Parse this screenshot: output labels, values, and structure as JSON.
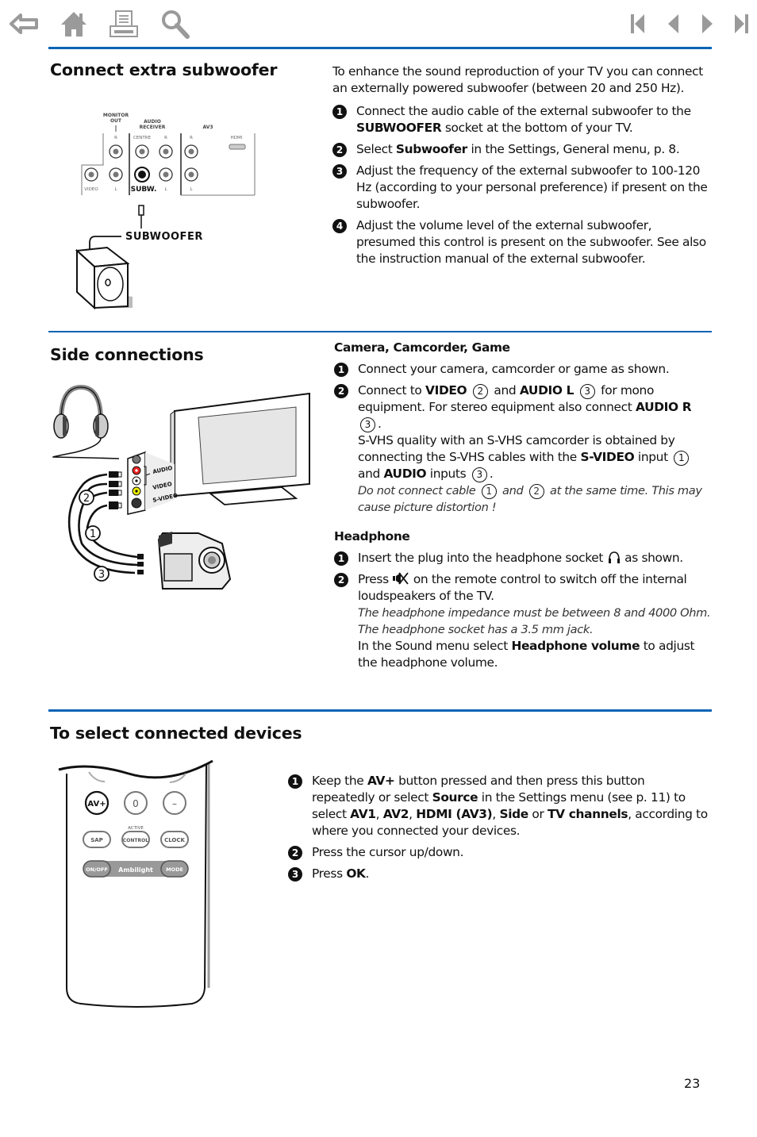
{
  "nav": {
    "left": [
      {
        "name": "back-icon"
      },
      {
        "name": "home-icon"
      },
      {
        "name": "print-icon"
      },
      {
        "name": "search-icon"
      }
    ],
    "right": [
      {
        "name": "first-page-icon"
      },
      {
        "name": "previous-page-icon"
      },
      {
        "name": "next-page-icon"
      },
      {
        "name": "last-page-icon"
      }
    ],
    "icon_color": "#9a9a9a"
  },
  "accent_color": "#0a64b4",
  "subwoofer": {
    "title": "Connect extra subwoofer",
    "intro": "To enhance the sound reproduction of your TV you can connect an externally powered subwoofer (between 20 and 250 Hz).",
    "steps": [
      {
        "num": "1",
        "pre": "Connect the audio cable of the external subwoofer to the ",
        "bold": "SUBWOOFER",
        "post": " socket at the bottom of your TV."
      },
      {
        "num": "2",
        "pre": "Select ",
        "bold": "Subwoofer",
        "post": " in the Settings, General menu, p. 8."
      },
      {
        "num": "3",
        "text": "Adjust the frequency of the external subwoofer to 100-120 Hz (according to your personal preference) if present on the subwoofer."
      },
      {
        "num": "4",
        "text": "Adjust the volume level of the external subwoofer, presumed this control is present on the subwoofer. See also the instruction manual of the external subwoofer."
      }
    ],
    "diagram": {
      "monitor_out": "MONITOR OUT",
      "audio_receiver": "AUDIO RECEIVER",
      "av3": "AV3",
      "r": "R",
      "l": "L",
      "centre": "CENTRE",
      "hdmi": "HDMI",
      "video": "VIDEO",
      "subw": "SUBW.",
      "subwoofer_label": "SUBWOOFER"
    }
  },
  "side": {
    "title": "Side connections",
    "camera_heading": "Camera, Camcorder, Game",
    "camera_steps": {
      "s1": "Connect your camera, camcorder or game as shown.",
      "s2_a": "Connect to ",
      "s2_video": "VIDEO",
      "s2_and": " and ",
      "s2_audiol": "AUDIO L",
      "s2_b": " for mono equipment. For stereo equipment also connect ",
      "s2_audior": "AUDIO R",
      "s2_c": "S-VHS quality with an S-VHS camcorder is obtained by connecting the S-VHS cables with the ",
      "s2_svideo": "S-VIDEO",
      "s2_d": " input ",
      "s2_e": " and ",
      "s2_audio": "AUDIO",
      "s2_f": " inputs ",
      "note_a": "Do not connect cable ",
      "note_and": " and ",
      "note_b": " at the same time. This may cause picture distortion !"
    },
    "headphone_heading": "Headphone",
    "headphone_steps": {
      "s1_a": "Insert the plug into the headphone socket ",
      "s1_b": " as shown.",
      "s2_a": "Press ",
      "s2_b": " on the remote control to switch off the internal loudspeakers of the TV.",
      "note": "The headphone impedance must be between 8 and 4000 Ohm. The headphone socket has a 3.5 mm jack.",
      "s2_c": "In the Sound menu select ",
      "s2_bold": "Headphone volume",
      "s2_d": " to adjust the headphone volume."
    },
    "diagram": {
      "audio": "AUDIO",
      "video": "VIDEO",
      "svideo": "S-VIDEO",
      "c1": "1",
      "c2": "2",
      "c3": "3"
    }
  },
  "select": {
    "title": "To select connected devices",
    "steps": {
      "s1_a": "Keep the ",
      "s1_av": "AV+",
      "s1_b": " button pressed and then press this button repeatedly or select ",
      "s1_source": "Source",
      "s1_c": " in the Settings menu (see p. 11) to select ",
      "s1_av1": "AV1",
      "s1_av2": "AV2",
      "s1_hdmi": "HDMI (AV3)",
      "s1_side": "Side",
      "s1_or": " or ",
      "s1_tv": "TV channels",
      "s1_d": ", according to where you connected your devices.",
      "s2": "Press the cursor up/down.",
      "s3_a": "Press ",
      "s3_ok": "OK"
    },
    "remote": {
      "av": "AV+",
      "zero": "0",
      "dash": "–",
      "active": "ACTIVE",
      "sap": "SAP",
      "control": "CONTROL",
      "clock": "CLOCK",
      "onoff": "ON/OFF",
      "ambilight": "Ambilight",
      "mode": "MODE"
    }
  },
  "page_number": "23"
}
